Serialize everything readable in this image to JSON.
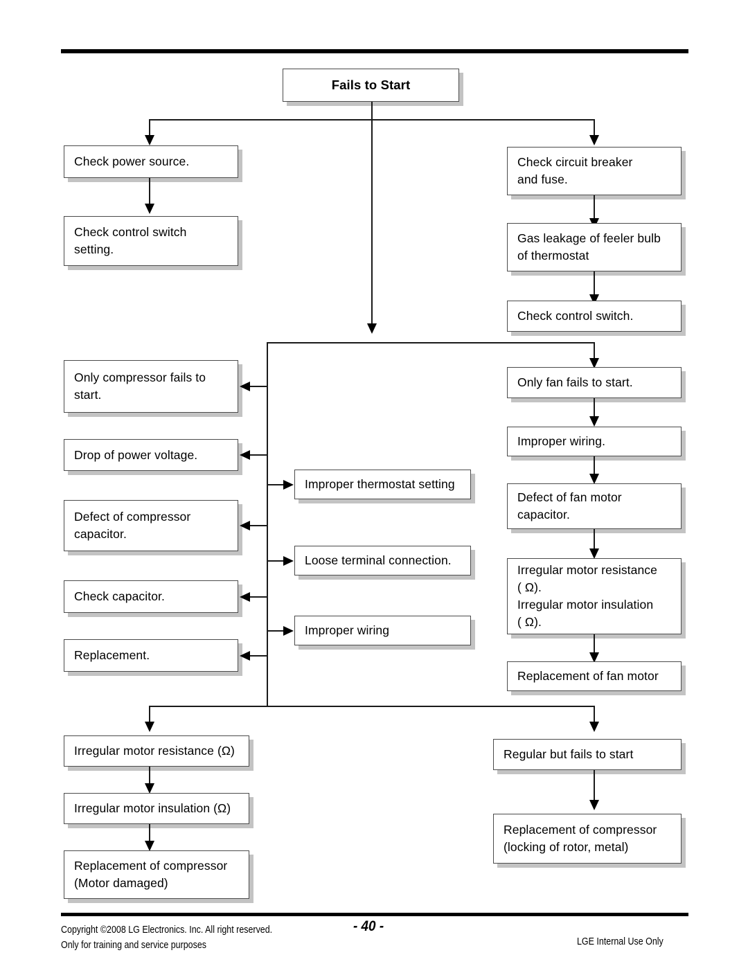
{
  "document": {
    "page_number": "- 40 -",
    "footer_copyright": "Copyright ©2008 LG Electronics. Inc. All right reserved.\nOnly for training and service purposes",
    "footer_notice": "LGE Internal Use Only"
  },
  "flowchart": {
    "title_node": {
      "label": "Fails to Start"
    },
    "left_branch": [
      {
        "label": "Check  power source."
      },
      {
        "label": "Check control switch\nsetting."
      }
    ],
    "right_branch": [
      {
        "label": "Check circuit breaker\nand fuse."
      },
      {
        "label": "Gas leakage of feeler bulb\nof thermostat"
      },
      {
        "label": "Check control switch."
      }
    ],
    "compressor_column": [
      {
        "label": "Only compressor fails to\nstart."
      },
      {
        "label": "Drop of power voltage."
      },
      {
        "label": "Defect of compressor\ncapacitor."
      },
      {
        "label": " Check capacitor."
      },
      {
        "label": "Replacement."
      }
    ],
    "center_column": [
      {
        "label": "Improper thermostat setting"
      },
      {
        "label": "Loose terminal connection."
      },
      {
        "label": "Improper wiring"
      }
    ],
    "fan_column": [
      {
        "label": "Only fan fails to start."
      },
      {
        "label": "Improper wiring."
      },
      {
        "label": "Defect of fan motor\ncapacitor."
      },
      {
        "label": "Irregular motor resistance\n( Ω).\nIrregular motor insulation\n( Ω)."
      },
      {
        "label": "Replacement of fan motor"
      }
    ],
    "bottom_left_column": [
      {
        "label": "Irregular motor resistance (Ω)"
      },
      {
        "label": "Irregular motor insulation (Ω)"
      },
      {
        "label": "Replacement of compressor\n(Motor damaged)"
      }
    ],
    "bottom_right_column": [
      {
        "label": "Regular but fails to start"
      },
      {
        "label": "Replacement of compressor\n(locking of rotor, metal)"
      }
    ]
  },
  "colors": {
    "box_border": "#4a4a4a",
    "box_shadow": "#c3c3c3",
    "line": "#1a1a1a",
    "rule": "#000000"
  }
}
